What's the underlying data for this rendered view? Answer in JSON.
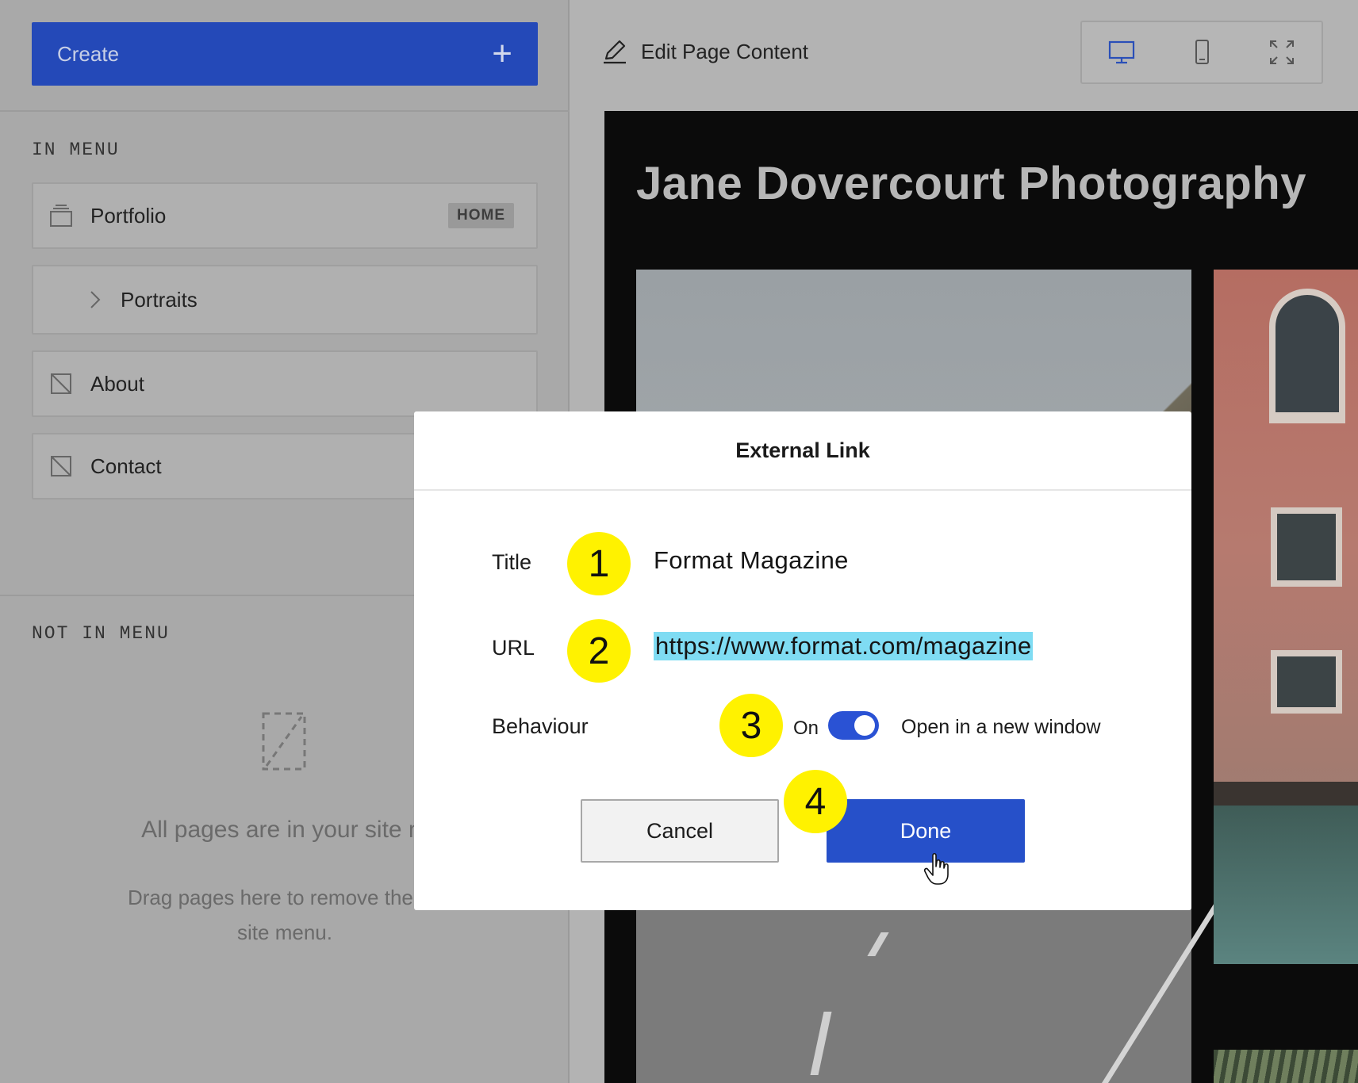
{
  "sidebar": {
    "create_label": "Create",
    "in_menu_label": "IN MENU",
    "not_in_menu_label": "NOT IN MENU",
    "items": [
      {
        "label": "Portfolio",
        "badge": "HOME",
        "icon": "gallery-icon"
      },
      {
        "label": "Portraits",
        "icon": "chevron-right-icon"
      },
      {
        "label": "About",
        "icon": "page-icon"
      },
      {
        "label": "Contact",
        "icon": "page-icon"
      }
    ],
    "empty_title": "All pages are in your site m",
    "empty_sub_line1": "Drag pages here to remove them f",
    "empty_sub_line2": "site menu."
  },
  "toolbar": {
    "edit_label": "Edit Page Content",
    "views": [
      "desktop-icon",
      "mobile-icon",
      "fullscreen-icon"
    ]
  },
  "preview": {
    "site_title": "Jane Dovercourt Photography"
  },
  "modal": {
    "title": "External Link",
    "title_label": "Title",
    "title_value": "Format Magazine",
    "url_label": "URL",
    "url_value": "https://www.format.com/magazine",
    "behaviour_label": "Behaviour",
    "toggle_state": "On",
    "toggle_text": "Open in a new window",
    "cancel_label": "Cancel",
    "done_label": "Done"
  },
  "steps": [
    "1",
    "2",
    "3",
    "4"
  ],
  "colors": {
    "accent": "#2650c9",
    "highlight": "#7fdcf3",
    "step_marker": "#fff200"
  }
}
